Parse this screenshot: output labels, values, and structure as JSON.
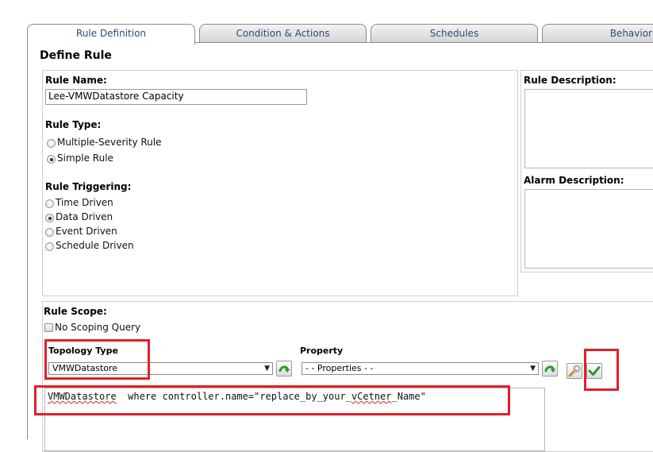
{
  "tabs": [
    {
      "label": "Rule Definition",
      "active": true
    },
    {
      "label": "Condition & Actions",
      "active": false
    },
    {
      "label": "Schedules",
      "active": false
    },
    {
      "label": "Behavior",
      "active": false
    }
  ],
  "page_title": "Define Rule",
  "rule_name": {
    "label": "Rule Name:",
    "value": "Lee-VMWDatastore Capacity"
  },
  "rule_type": {
    "label": "Rule Type:",
    "options": [
      {
        "label": "Multiple-Severity Rule",
        "selected": false
      },
      {
        "label": "Simple Rule",
        "selected": true
      }
    ]
  },
  "rule_triggering": {
    "label": "Rule Triggering:",
    "options": [
      {
        "label": "Time Driven",
        "selected": false
      },
      {
        "label": "Data Driven",
        "selected": true
      },
      {
        "label": "Event Driven",
        "selected": false
      },
      {
        "label": "Schedule Driven",
        "selected": false
      }
    ]
  },
  "rule_description": {
    "label": "Rule Description:"
  },
  "alarm_description": {
    "label": "Alarm Description:"
  },
  "rule_scope": {
    "label": "Rule Scope:",
    "no_scoping_label": "No Scoping Query",
    "topology_type_label": "Topology Type",
    "topology_type_value": "VMWDatastore",
    "property_label": "Property",
    "property_value": "- - Properties - -"
  },
  "query": {
    "prefix": "VMWDatastore",
    "middle": "  where controller.name=\"replace_by_your_",
    "misspelled": "vCetner",
    "suffix": "_Name\""
  },
  "icons": {
    "topology_refresh": "green-refresh-arrow-icon",
    "property_refresh": "green-refresh-arrow-icon",
    "wrench": "wrench-icon",
    "apply": "green-checkmark-icon"
  },
  "colors": {
    "tab_text": "#2e4a78",
    "highlight_red": "#e0202a",
    "icon_green": "#2c9a2c"
  }
}
